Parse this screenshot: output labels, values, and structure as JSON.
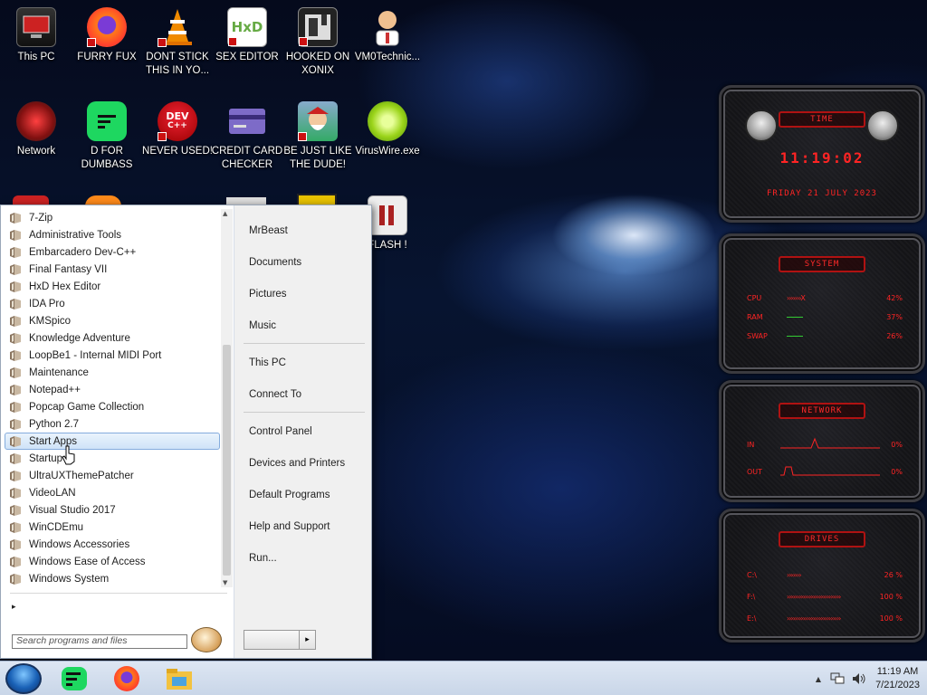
{
  "desktop": {
    "icons": [
      {
        "label": "This PC"
      },
      {
        "label": "FURRY FUX"
      },
      {
        "label": "DONT STICK THIS IN YO..."
      },
      {
        "label": "SEX EDITOR"
      },
      {
        "label": "HOOKED ON XONIX"
      },
      {
        "label": "VM0Technic..."
      },
      {
        "label": "Network"
      },
      {
        "label": "D FOR DUMBASS"
      },
      {
        "label": "NEVER USED!"
      },
      {
        "label": "CREDIT CARD CHECKER"
      },
      {
        "label": "BE JUST LIKE THE DUDE!"
      },
      {
        "label": "VirusWire.exe"
      },
      {
        "label": "FLASH !"
      }
    ],
    "icon_glyphs": {
      "hxd": "HxD",
      "dev": "DEV",
      "dev_sub": "C++"
    }
  },
  "start_menu": {
    "programs": [
      "7-Zip",
      "Administrative Tools",
      "Embarcadero Dev-C++",
      "Final Fantasy VII",
      "HxD Hex Editor",
      "IDA Pro",
      "KMSpico",
      "Knowledge Adventure",
      "LoopBe1 - Internal MIDI Port",
      "Maintenance",
      "Notepad++",
      "Popcap Game Collection",
      "Python 2.7",
      "Start Apps",
      "Startup",
      "UltraUXThemePatcher",
      "VideoLAN",
      "Visual Studio 2017",
      "WinCDEmu",
      "Windows Accessories",
      "Windows Ease of Access",
      "Windows System"
    ],
    "highlighted_program": "Start Apps",
    "back_arrow": "▸",
    "search_placeholder": "Search programs and files",
    "right_items": {
      "user": "MrBeast",
      "documents": "Documents",
      "pictures": "Pictures",
      "music": "Music",
      "this_pc": "This PC",
      "connect_to": "Connect To",
      "control_panel": "Control Panel",
      "devices_printers": "Devices and Printers",
      "default_programs": "Default Programs",
      "help_support": "Help and Support",
      "run": "Run..."
    },
    "shutdown_arrow": "▸"
  },
  "gadgets": {
    "time": {
      "title": "TIME",
      "clock": "11:19:02",
      "date": "FRIDAY 21 JULY 2023"
    },
    "system": {
      "title": "SYSTEM",
      "rows": [
        {
          "label": "CPU",
          "bar": "›››››››X",
          "value": "42%"
        },
        {
          "label": "RAM",
          "bar": "",
          "value": "37%"
        },
        {
          "label": "SWAP",
          "bar": "",
          "value": "26%"
        }
      ]
    },
    "network": {
      "title": "NETWORK",
      "rows": [
        {
          "label": "IN",
          "value": "0%"
        },
        {
          "label": "OUT",
          "value": "0%"
        }
      ]
    },
    "drives": {
      "title": "DRIVES",
      "rows": [
        {
          "label": "C:\\",
          "bar": "›››››››",
          "value": "26 %"
        },
        {
          "label": "F:\\",
          "bar": "›››››››››››››››››››››››››››",
          "value": "100 %"
        },
        {
          "label": "E:\\",
          "bar": "›››››››››››››››››››››››››››",
          "value": "100 %"
        }
      ]
    }
  },
  "taskbar": {
    "tray_arrow": "▲",
    "clock_time": "11:19 AM",
    "clock_date": "7/21/2023"
  },
  "colors": {
    "accent": "#ff2424",
    "highlight": "#cfe3f8"
  }
}
